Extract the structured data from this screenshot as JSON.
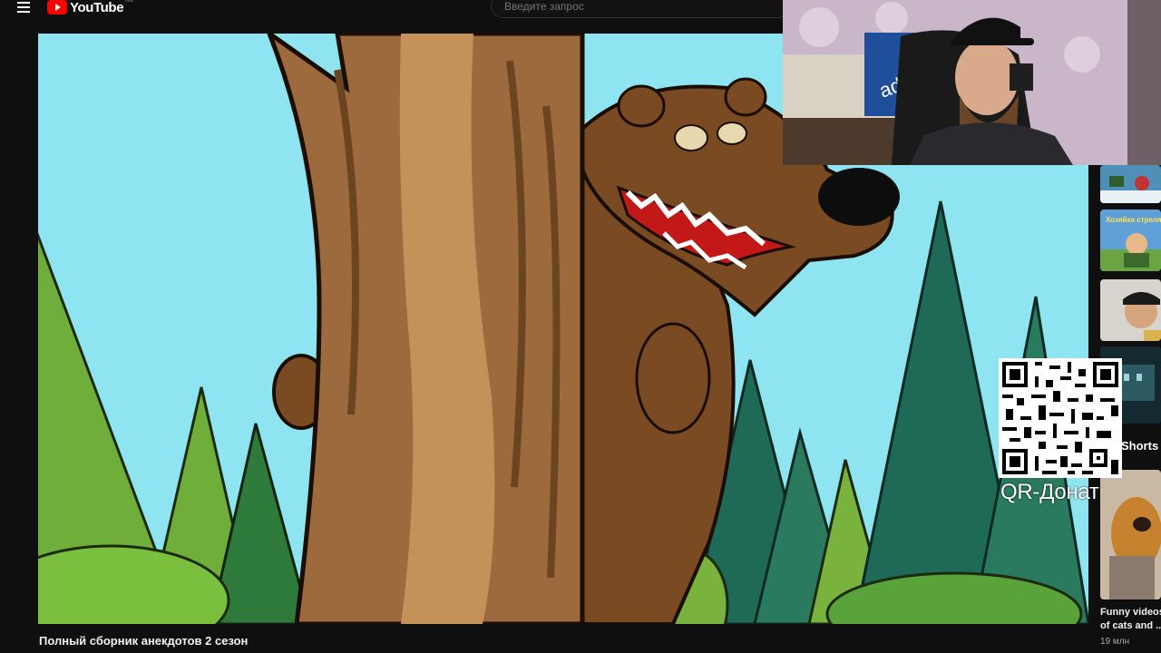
{
  "header": {
    "logo_text": "YouTube",
    "logo_region": "RU",
    "search_placeholder": "Введите запрос"
  },
  "video": {
    "title": "Полный сборник анекдотов 2 сезон"
  },
  "sidebar": {
    "shorts_label": "Shorts",
    "featured": {
      "title_line1": "Funny videos",
      "title_line2": "of cats and ...",
      "views": "19 млн"
    },
    "thumb2_caption": "Хозяйка стреляет"
  },
  "overlay": {
    "qr_label": "QR-Донат"
  },
  "colors": {
    "background": "#0f0f0f",
    "youtube_red": "#ff0000",
    "sky": "#8fe3ef"
  }
}
